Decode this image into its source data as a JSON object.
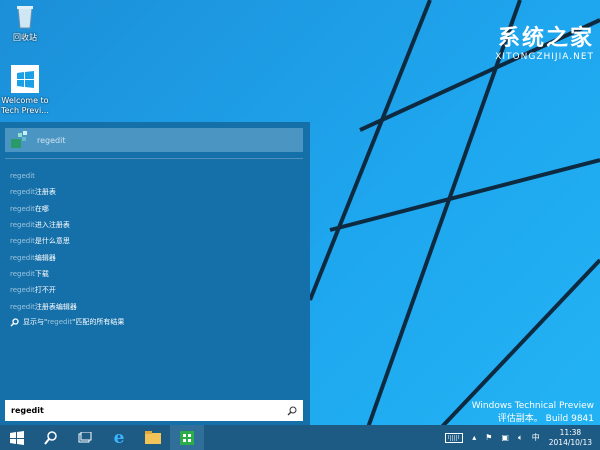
{
  "desktop": {
    "icons": [
      {
        "label": "回收站",
        "icon": "recycle-bin-icon"
      },
      {
        "label": "Welcome to Tech Previ...",
        "icon": "windows-shortcut-icon"
      }
    ]
  },
  "watermark": {
    "cn": "系统之家",
    "en": "XITONGZHIJIA.NET"
  },
  "start": {
    "top_result": "regedit",
    "query": "regedit",
    "suggestions": [
      {
        "q": "regedit",
        "s": ""
      },
      {
        "q": "regedit",
        "s": "注册表"
      },
      {
        "q": "regedit",
        "s": "在哪"
      },
      {
        "q": "regedit",
        "s": " 进入注册表"
      },
      {
        "q": "regedit",
        "s": "是什么意思"
      },
      {
        "q": "regedit",
        "s": "编辑器"
      },
      {
        "q": "regedit",
        "s": "下载"
      },
      {
        "q": "regedit",
        "s": "打不开"
      },
      {
        "q": "regedit",
        "s": "注册表编辑器"
      }
    ],
    "all_results": {
      "pre": "显示与\"",
      "q": "regedit",
      "post": "\"匹配的所有结果"
    },
    "search_value": "regedit"
  },
  "wininfo": {
    "line1": "Windows Technical Preview",
    "line2": "评估副本。 Build 9841"
  },
  "tray": {
    "ime": "中",
    "time": "11:38",
    "date": "2014/10/13"
  },
  "colors": {
    "desktop": "#1ea6ee",
    "start": "#1570aa",
    "taskbar": "#1d5b85"
  }
}
